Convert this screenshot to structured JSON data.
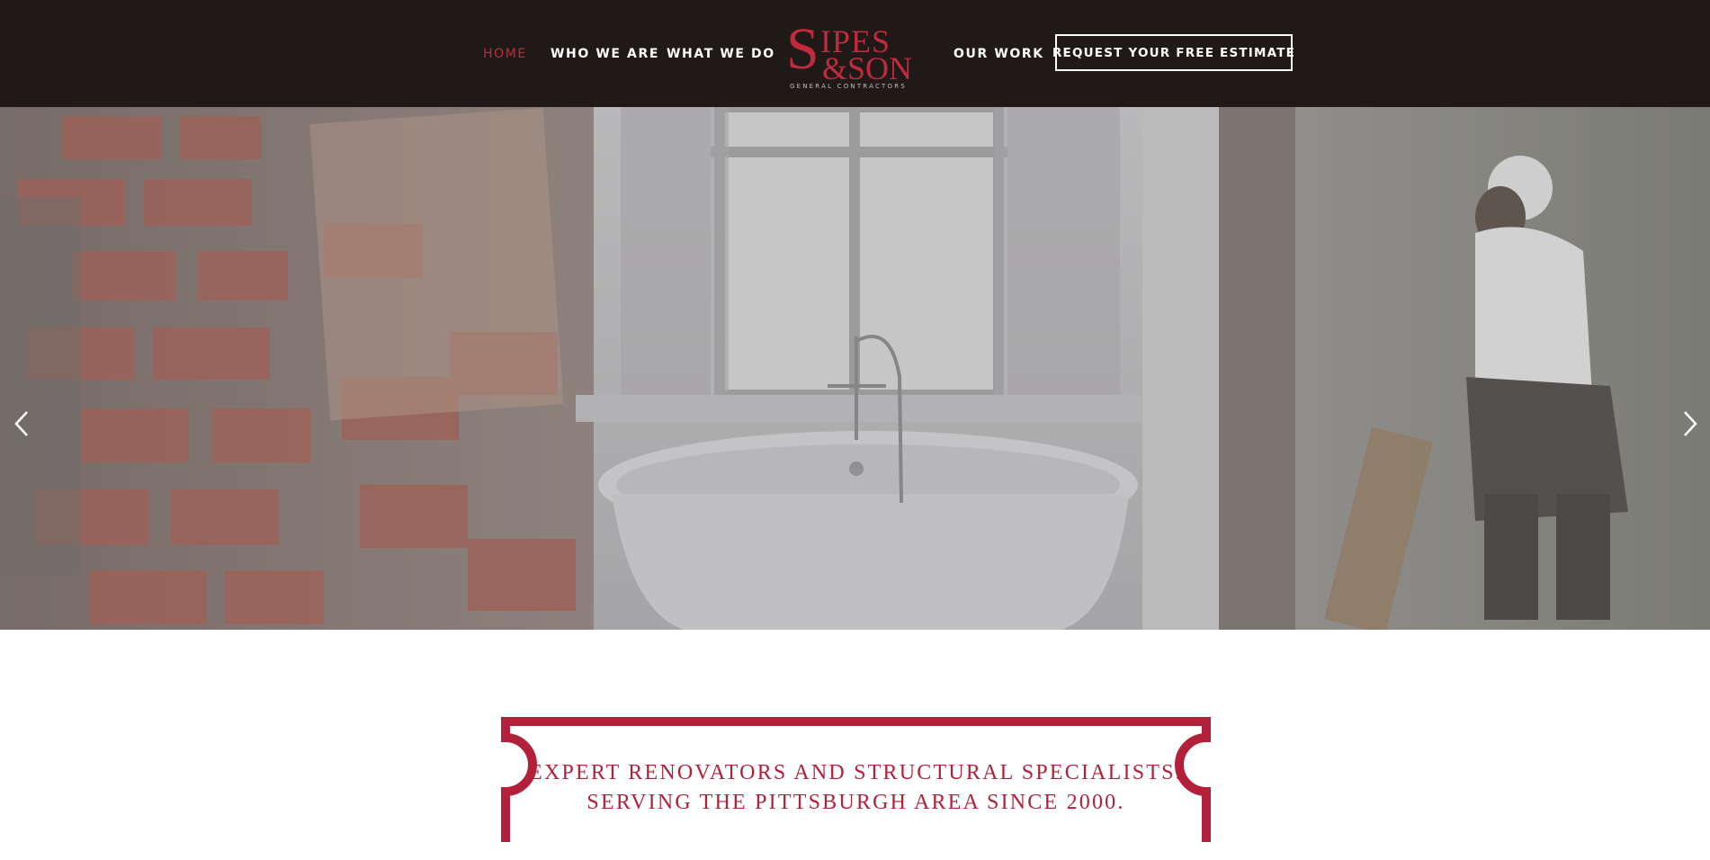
{
  "brand": {
    "logo_main_s": "S",
    "logo_main_rest": "IPES",
    "logo_amp_son": "&SON",
    "logo_sub": "GENERAL CONTRACTORS",
    "color_primary": "#b3203a",
    "color_header": "#1f1a18"
  },
  "nav": {
    "home": "HOME",
    "who": "WHO WE ARE",
    "what": "WHAT WE DO",
    "work": "OUR WORK",
    "cta": "REQUEST YOUR FREE ESTIMATE"
  },
  "hero": {
    "prev_icon": "chevron-left-icon",
    "next_icon": "chevron-right-icon"
  },
  "tagline": {
    "line1": "EXPERT RENOVATORS AND STRUCTURAL SPECIALISTS.",
    "line2": "SERVING THE PITTSBURGH AREA SINCE 2000."
  }
}
